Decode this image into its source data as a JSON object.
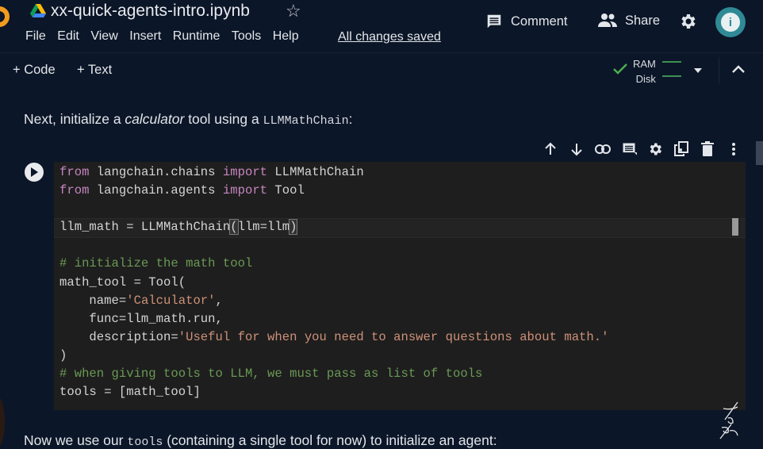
{
  "header": {
    "title": "xx-quick-agents-intro.ipynb",
    "menu": [
      "File",
      "Edit",
      "View",
      "Insert",
      "Runtime",
      "Tools",
      "Help"
    ],
    "save_status": "All changes saved",
    "comment_label": "Comment",
    "share_label": "Share",
    "avatar_letter": "i",
    "icons": [
      "colab-logo",
      "drive-icon",
      "star-icon",
      "comment-icon",
      "share-icon",
      "settings-icon",
      "avatar"
    ]
  },
  "toolbar": {
    "add_code_label": "+ Code",
    "add_text_label": "+ Text",
    "ram_label": "RAM",
    "disk_label": "Disk",
    "connected": true,
    "colors": {
      "check": "#4caf50",
      "bar": "#3f8f55"
    }
  },
  "markdown_1": {
    "prefix": "Next, initialize a ",
    "emphasis": "calculator",
    "middle": " tool using a ",
    "code": "LLMMathChain",
    "suffix": ":"
  },
  "cell_toolbar": {
    "icons": [
      "arrow-up-icon",
      "arrow-down-icon",
      "link-icon",
      "comment-icon",
      "gear-icon",
      "mirror-cell-icon",
      "trash-icon",
      "more-vert-icon"
    ]
  },
  "code_cell": {
    "lines": [
      {
        "t": [
          [
            "kw",
            "from"
          ],
          [
            "p",
            " langchain.chains "
          ],
          [
            "kw",
            "import"
          ],
          [
            "p",
            " LLMMathChain"
          ]
        ]
      },
      {
        "t": [
          [
            "kw",
            "from"
          ],
          [
            "p",
            " langchain.agents "
          ],
          [
            "kw",
            "import"
          ],
          [
            "p",
            " Tool"
          ]
        ]
      },
      {
        "t": [
          [
            "p",
            ""
          ]
        ]
      },
      {
        "t": [
          [
            "p",
            "llm_math = LLMMathChain"
          ],
          [
            "box",
            "("
          ],
          [
            "p",
            "llm=llm"
          ],
          [
            "box",
            ")"
          ]
        ]
      },
      {
        "t": [
          [
            "p",
            ""
          ]
        ]
      },
      {
        "t": [
          [
            "cmt",
            "# initialize the math tool"
          ]
        ]
      },
      {
        "t": [
          [
            "p",
            "math_tool = Tool("
          ]
        ]
      },
      {
        "t": [
          [
            "p",
            "    name="
          ],
          [
            "str",
            "'Calculator'"
          ],
          [
            "p",
            ","
          ]
        ]
      },
      {
        "t": [
          [
            "p",
            "    func=llm_math.run,"
          ]
        ]
      },
      {
        "t": [
          [
            "p",
            "    description="
          ],
          [
            "str",
            "'Useful for when you need to answer questions about math.'"
          ]
        ]
      },
      {
        "t": [
          [
            "p",
            ")"
          ]
        ]
      },
      {
        "t": [
          [
            "cmt",
            "# when giving tools to LLM, we must pass as list of tools"
          ]
        ]
      },
      {
        "t": [
          [
            "p",
            "tools = [math_tool]"
          ]
        ]
      }
    ],
    "colors": {
      "keyword": "#c586c0",
      "string": "#ce9178",
      "comment": "#6a9955",
      "plain": "#d4d4d4",
      "background": "#1e1e1e"
    }
  },
  "markdown_2": {
    "prefix": "Now we use our ",
    "code": "tools",
    "suffix": " (containing a single tool for now) to initialize an agent:"
  },
  "watermark": "James Briggs"
}
